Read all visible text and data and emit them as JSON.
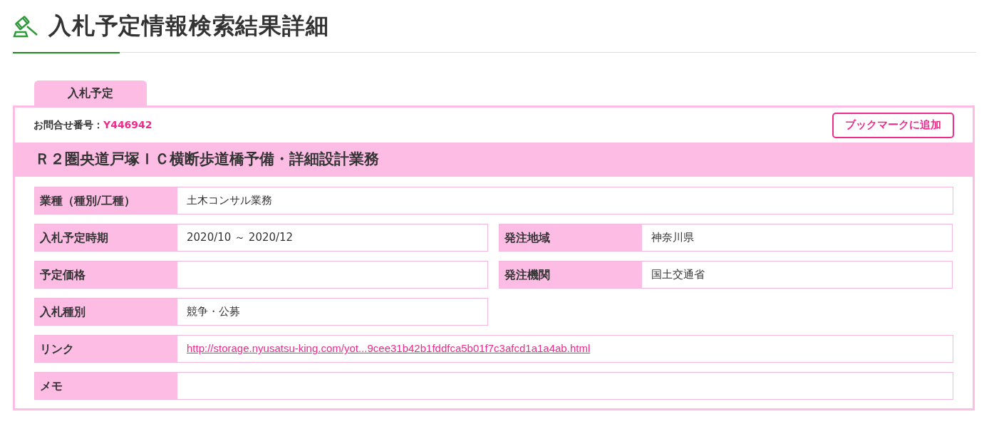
{
  "page": {
    "title": "入札予定情報検索結果詳細"
  },
  "tab": {
    "label": "入札予定"
  },
  "inquiry": {
    "label": "お問合せ番号：",
    "number": "Y446942"
  },
  "bookmark_button": "ブックマークに追加",
  "project_title": "Ｒ２圏央道戸塚ＩＣ横断歩道橋予備・詳細設計業務",
  "rows": [
    {
      "cells": [
        {
          "label": "業種（種別/工種）",
          "value": "土木コンサル業務",
          "kind": "wide"
        }
      ]
    },
    {
      "cells": [
        {
          "label": "入札予定時期",
          "value": "2020/10 ～ 2020/12",
          "kind": "half"
        },
        {
          "label": "発注地域",
          "value": "神奈川県",
          "kind": "half"
        }
      ]
    },
    {
      "cells": [
        {
          "label": "予定価格",
          "kind": "half"
        },
        {
          "label": "発注機関",
          "value": "国土交通省",
          "kind": "half"
        }
      ]
    },
    {
      "cells": [
        {
          "label": "入札種別",
          "value": "競争・公募",
          "kind": "half"
        }
      ]
    },
    {
      "cells": [
        {
          "label": "リンク",
          "value": "http://storage.nyusatsu-king.com/yot...9cee31b42b1fddfca5b01f7c3afcd1a1a4ab.html",
          "kind": "link"
        }
      ]
    },
    {
      "cells": [
        {
          "label": "メモ",
          "kind": "wide"
        }
      ]
    }
  ]
}
